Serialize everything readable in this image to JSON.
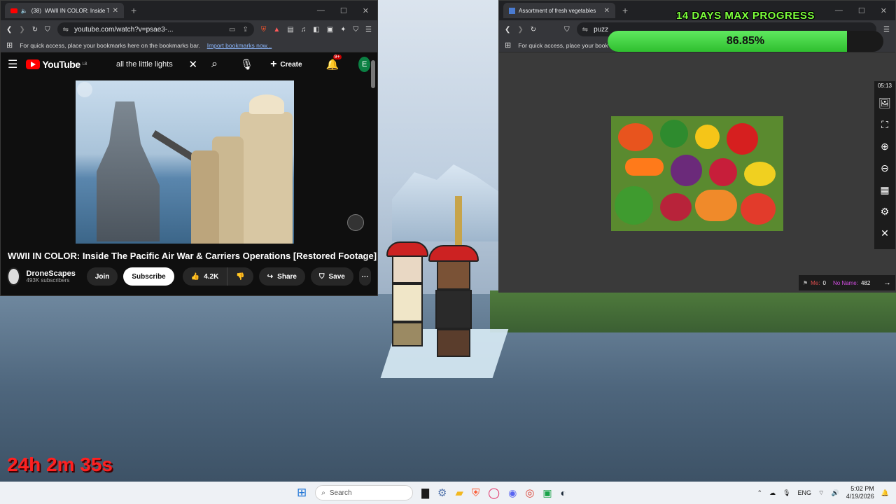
{
  "overlay": {
    "days_title": "14 DAYS MAX PROGRESS",
    "progress_percent": 86.85,
    "progress_text": "86.85%",
    "timer": "24h 2m 35s"
  },
  "left_browser": {
    "tab_count_badge": "(38)",
    "tab_title": "WWII IN COLOR: Inside T",
    "url": "youtube.com/watch?v=psae3-...",
    "bookmarks_text": "For quick access, place your bookmarks here on the bookmarks bar.",
    "import_link": "Import bookmarks now...",
    "youtube": {
      "logo": "YouTube",
      "region": "LB",
      "search_value": "all the little lights",
      "create_label": "Create",
      "notif_badge": "9+",
      "avatar": "E",
      "video_title": "WWII IN COLOR: Inside The Pacific Air War & Carriers Operations [Restored Footage]",
      "channel": "DroneScapes",
      "subscribers": "493K subscribers",
      "join": "Join",
      "subscribe": "Subscribe",
      "likes": "4.2K",
      "share": "Share",
      "save": "Save"
    }
  },
  "right_browser": {
    "tab_title": "Assortment of fresh vegetables",
    "url": "puzz",
    "bookmarks_text": "For quick access, place your book",
    "timer": "05:13",
    "me_label": "Me:",
    "me_score": "0",
    "noname_label": "No Name:",
    "noname_score": "482"
  },
  "taskbar": {
    "search_placeholder": "Search",
    "lang": "ENG",
    "time": "5:02 PM",
    "date": "4/19/2026"
  },
  "colors": {
    "progress_fill": "#3ed13e",
    "overlay_title": "#7cff3c",
    "timer": "#ff2020"
  }
}
